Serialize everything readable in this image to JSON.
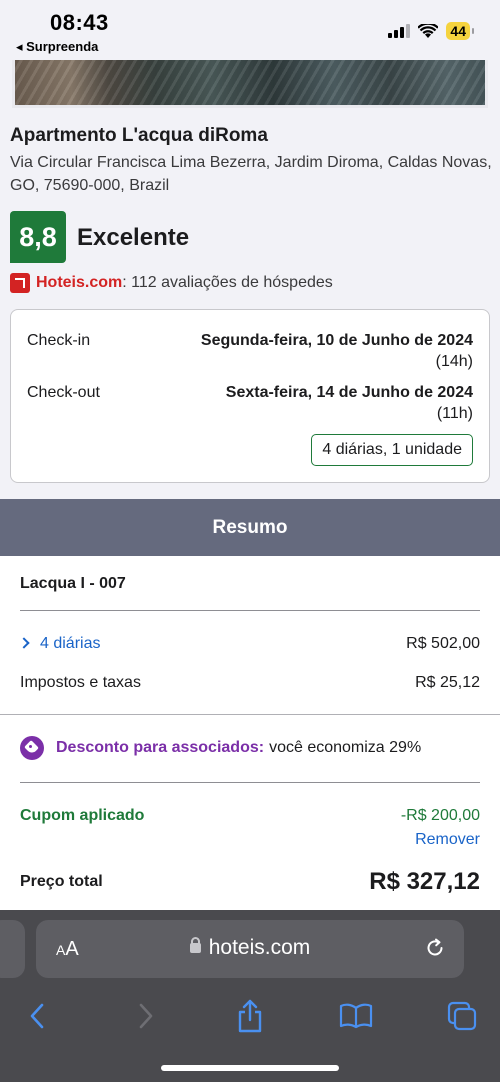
{
  "status": {
    "time": "08:43",
    "back_app": "◂ Surpreenda",
    "battery": "44"
  },
  "property": {
    "name": "Apartmento L'acqua diRoma",
    "address": "Via Circular Francisca Lima Bezerra, Jardim Diroma, Caldas Novas, GO, 75690-000, Brazil",
    "rating_score": "8,8",
    "rating_label": "Excelente",
    "brand": "Hoteis.com",
    "reviews_text": ": 112 avaliações de hóspedes"
  },
  "dates": {
    "checkin_label": "Check-in",
    "checkin_date": "Segunda-feira, 10 de Junho de 2024",
    "checkin_time": "(14h)",
    "checkout_label": "Check-out",
    "checkout_date": "Sexta-feira, 14 de Junho de 2024",
    "checkout_time": "(11h)",
    "nights_units": "4 diárias, 1 unidade"
  },
  "summary": {
    "title": "Resumo",
    "room_name": "Lacqua I - 007",
    "nights_label": "4 diárias",
    "nights_price": "R$ 502,00",
    "taxes_label": "Impostos e taxas",
    "taxes_price": "R$ 25,12",
    "discount_label": "Desconto para associados:",
    "discount_text": "você economiza 29%",
    "coupon_label": "Cupom aplicado",
    "coupon_value": "-R$ 200,00",
    "coupon_remove": "Remover",
    "total_label": "Preço total",
    "total_price": "R$ 327,12"
  },
  "browser": {
    "text_size_small": "A",
    "text_size_large": "A",
    "url": "hoteis.com"
  }
}
